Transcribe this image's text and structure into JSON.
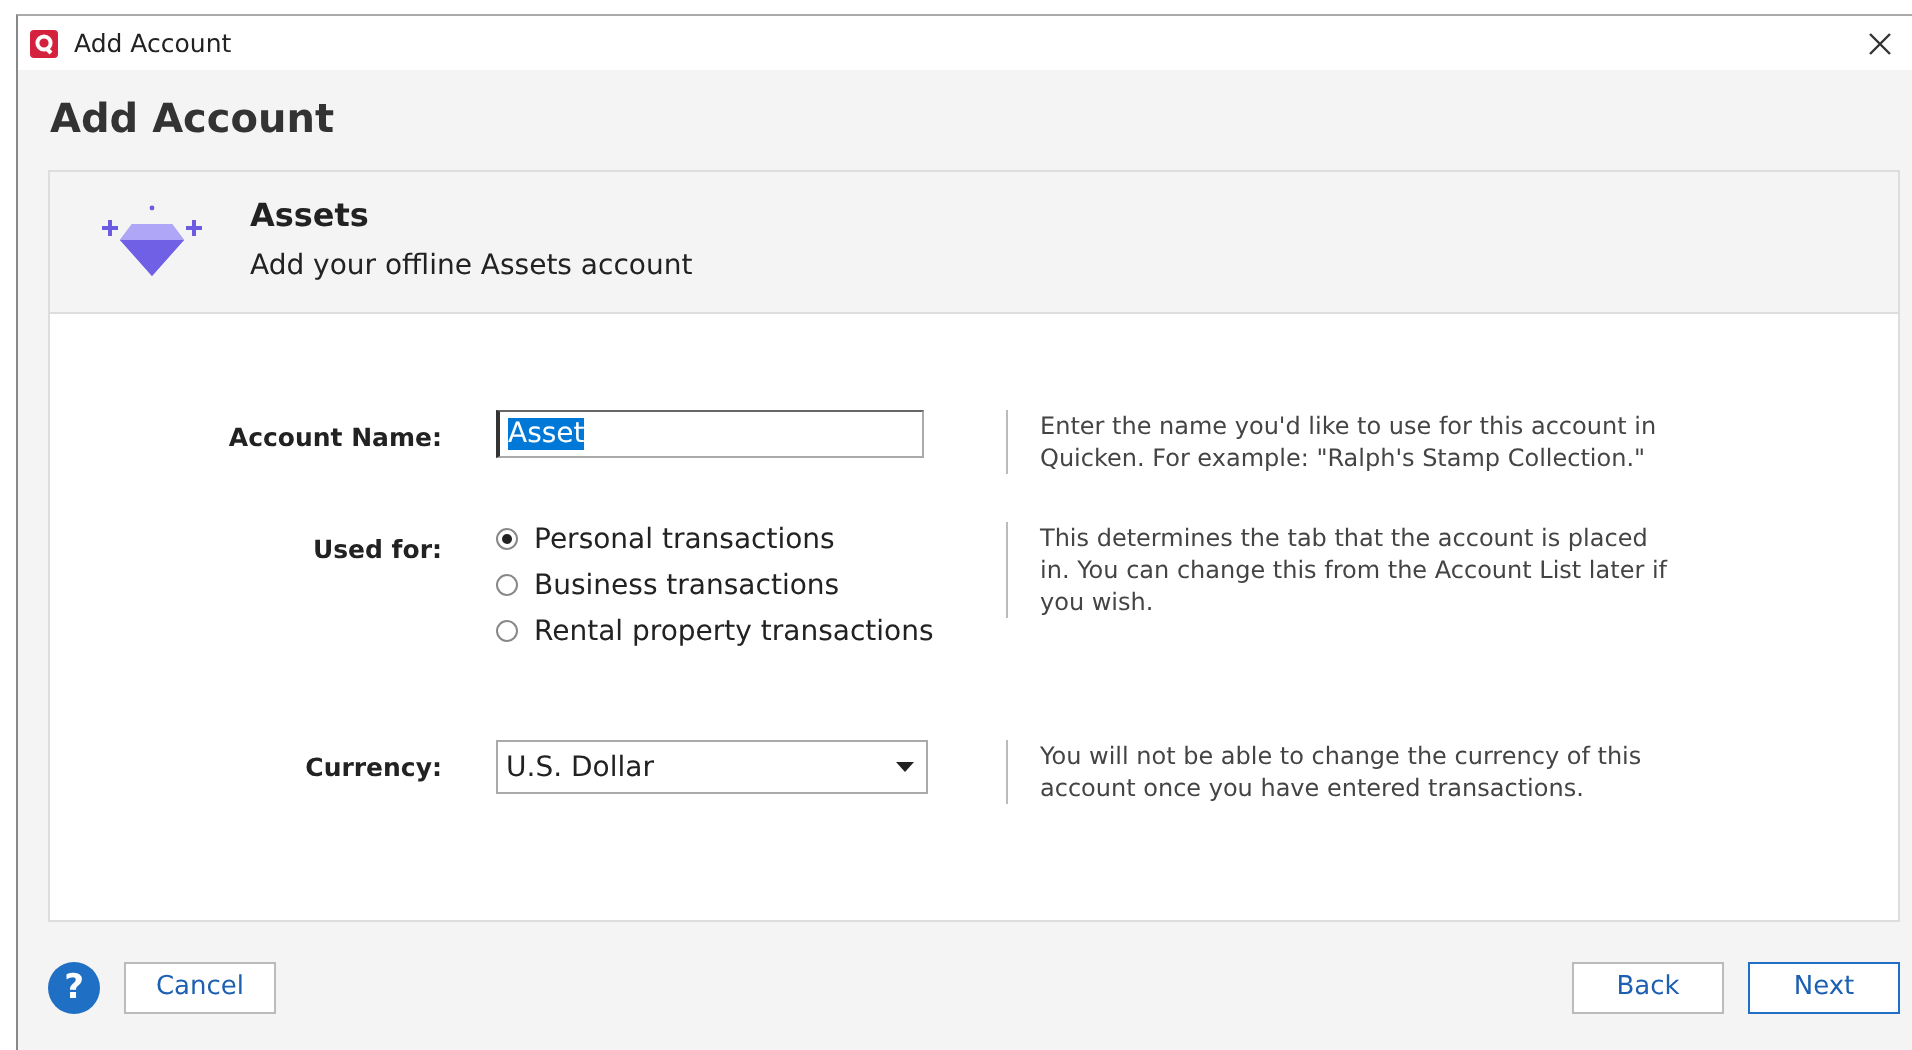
{
  "window": {
    "title": "Add Account"
  },
  "heading": "Add Account",
  "account_type": {
    "title": "Assets",
    "subtitle": "Add your offline Assets account"
  },
  "fields": [
    {
      "kind": "text",
      "label": "Account Name:",
      "value": "Asset",
      "text_selected": true,
      "help": "Enter the name you'd like to use for this account in Quicken. For example: \"Ralph's Stamp Collection.\""
    },
    {
      "kind": "radio",
      "label": "Used for:",
      "options": [
        {
          "label": "Personal transactions",
          "selected": true
        },
        {
          "label": "Business transactions",
          "selected": false
        },
        {
          "label": "Rental property transactions",
          "selected": false
        }
      ],
      "help": "This determines the tab that the account is placed in. You can change this from the Account List later if you wish."
    },
    {
      "kind": "dropdown",
      "label": "Currency:",
      "value": "U.S. Dollar",
      "help": "You will not be able to change the currency of this account once you have entered transactions."
    }
  ],
  "footer": {
    "help_button": "?",
    "cancel": "Cancel",
    "back": "Back",
    "next": "Next"
  }
}
